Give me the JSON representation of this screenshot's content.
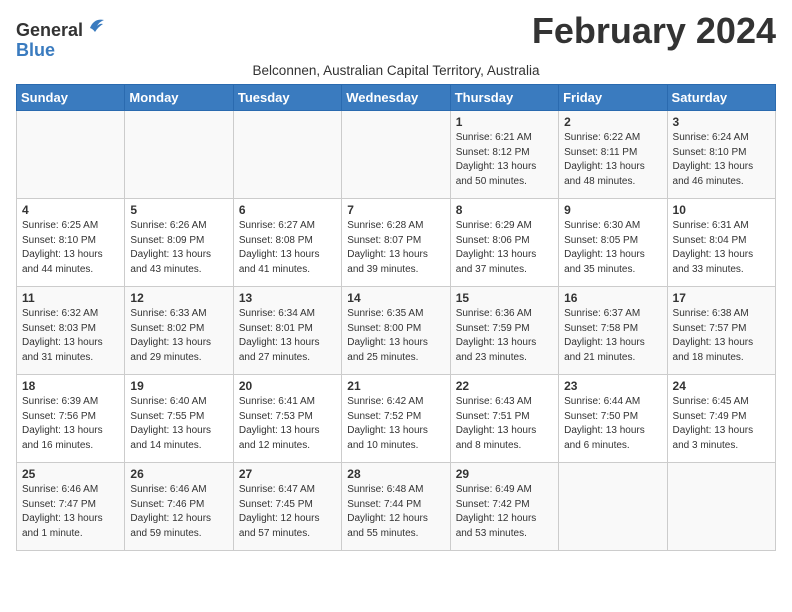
{
  "header": {
    "logo_general": "General",
    "logo_blue": "Blue",
    "title": "February 2024",
    "subtitle": "Belconnen, Australian Capital Territory, Australia"
  },
  "days_of_week": [
    "Sunday",
    "Monday",
    "Tuesday",
    "Wednesday",
    "Thursday",
    "Friday",
    "Saturday"
  ],
  "weeks": [
    [
      {
        "day": "",
        "info": ""
      },
      {
        "day": "",
        "info": ""
      },
      {
        "day": "",
        "info": ""
      },
      {
        "day": "",
        "info": ""
      },
      {
        "day": "1",
        "info": "Sunrise: 6:21 AM\nSunset: 8:12 PM\nDaylight: 13 hours\nand 50 minutes."
      },
      {
        "day": "2",
        "info": "Sunrise: 6:22 AM\nSunset: 8:11 PM\nDaylight: 13 hours\nand 48 minutes."
      },
      {
        "day": "3",
        "info": "Sunrise: 6:24 AM\nSunset: 8:10 PM\nDaylight: 13 hours\nand 46 minutes."
      }
    ],
    [
      {
        "day": "4",
        "info": "Sunrise: 6:25 AM\nSunset: 8:10 PM\nDaylight: 13 hours\nand 44 minutes."
      },
      {
        "day": "5",
        "info": "Sunrise: 6:26 AM\nSunset: 8:09 PM\nDaylight: 13 hours\nand 43 minutes."
      },
      {
        "day": "6",
        "info": "Sunrise: 6:27 AM\nSunset: 8:08 PM\nDaylight: 13 hours\nand 41 minutes."
      },
      {
        "day": "7",
        "info": "Sunrise: 6:28 AM\nSunset: 8:07 PM\nDaylight: 13 hours\nand 39 minutes."
      },
      {
        "day": "8",
        "info": "Sunrise: 6:29 AM\nSunset: 8:06 PM\nDaylight: 13 hours\nand 37 minutes."
      },
      {
        "day": "9",
        "info": "Sunrise: 6:30 AM\nSunset: 8:05 PM\nDaylight: 13 hours\nand 35 minutes."
      },
      {
        "day": "10",
        "info": "Sunrise: 6:31 AM\nSunset: 8:04 PM\nDaylight: 13 hours\nand 33 minutes."
      }
    ],
    [
      {
        "day": "11",
        "info": "Sunrise: 6:32 AM\nSunset: 8:03 PM\nDaylight: 13 hours\nand 31 minutes."
      },
      {
        "day": "12",
        "info": "Sunrise: 6:33 AM\nSunset: 8:02 PM\nDaylight: 13 hours\nand 29 minutes."
      },
      {
        "day": "13",
        "info": "Sunrise: 6:34 AM\nSunset: 8:01 PM\nDaylight: 13 hours\nand 27 minutes."
      },
      {
        "day": "14",
        "info": "Sunrise: 6:35 AM\nSunset: 8:00 PM\nDaylight: 13 hours\nand 25 minutes."
      },
      {
        "day": "15",
        "info": "Sunrise: 6:36 AM\nSunset: 7:59 PM\nDaylight: 13 hours\nand 23 minutes."
      },
      {
        "day": "16",
        "info": "Sunrise: 6:37 AM\nSunset: 7:58 PM\nDaylight: 13 hours\nand 21 minutes."
      },
      {
        "day": "17",
        "info": "Sunrise: 6:38 AM\nSunset: 7:57 PM\nDaylight: 13 hours\nand 18 minutes."
      }
    ],
    [
      {
        "day": "18",
        "info": "Sunrise: 6:39 AM\nSunset: 7:56 PM\nDaylight: 13 hours\nand 16 minutes."
      },
      {
        "day": "19",
        "info": "Sunrise: 6:40 AM\nSunset: 7:55 PM\nDaylight: 13 hours\nand 14 minutes."
      },
      {
        "day": "20",
        "info": "Sunrise: 6:41 AM\nSunset: 7:53 PM\nDaylight: 13 hours\nand 12 minutes."
      },
      {
        "day": "21",
        "info": "Sunrise: 6:42 AM\nSunset: 7:52 PM\nDaylight: 13 hours\nand 10 minutes."
      },
      {
        "day": "22",
        "info": "Sunrise: 6:43 AM\nSunset: 7:51 PM\nDaylight: 13 hours\nand 8 minutes."
      },
      {
        "day": "23",
        "info": "Sunrise: 6:44 AM\nSunset: 7:50 PM\nDaylight: 13 hours\nand 6 minutes."
      },
      {
        "day": "24",
        "info": "Sunrise: 6:45 AM\nSunset: 7:49 PM\nDaylight: 13 hours\nand 3 minutes."
      }
    ],
    [
      {
        "day": "25",
        "info": "Sunrise: 6:46 AM\nSunset: 7:47 PM\nDaylight: 13 hours\nand 1 minute."
      },
      {
        "day": "26",
        "info": "Sunrise: 6:46 AM\nSunset: 7:46 PM\nDaylight: 12 hours\nand 59 minutes."
      },
      {
        "day": "27",
        "info": "Sunrise: 6:47 AM\nSunset: 7:45 PM\nDaylight: 12 hours\nand 57 minutes."
      },
      {
        "day": "28",
        "info": "Sunrise: 6:48 AM\nSunset: 7:44 PM\nDaylight: 12 hours\nand 55 minutes."
      },
      {
        "day": "29",
        "info": "Sunrise: 6:49 AM\nSunset: 7:42 PM\nDaylight: 12 hours\nand 53 minutes."
      },
      {
        "day": "",
        "info": ""
      },
      {
        "day": "",
        "info": ""
      }
    ]
  ]
}
